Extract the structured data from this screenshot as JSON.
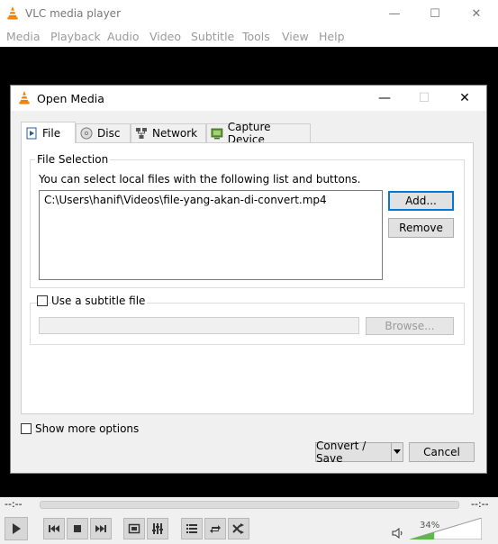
{
  "app": {
    "title": "VLC media player",
    "window_controls": {
      "minimize": "—",
      "maximize": "☐",
      "close": "✕"
    }
  },
  "menubar": {
    "items": [
      "Media",
      "Playback",
      "Audio",
      "Video",
      "Subtitle",
      "Tools",
      "View",
      "Help"
    ]
  },
  "playback": {
    "time_elapsed": "--:--",
    "time_total": "--:--",
    "volume_percent_label": "34%",
    "volume_fraction": 0.34
  },
  "dialog": {
    "title": "Open Media",
    "tabs": [
      {
        "label": "File",
        "icon": "file-icon",
        "active": true
      },
      {
        "label": "Disc",
        "icon": "disc-icon",
        "active": false
      },
      {
        "label": "Network",
        "icon": "network-icon",
        "active": false
      },
      {
        "label": "Capture Device",
        "icon": "capture-device-icon",
        "active": false
      }
    ],
    "file_selection": {
      "group_label": "File Selection",
      "description": "You can select local files with the following list and buttons.",
      "files": [
        "C:\\Users\\hanif\\Videos\\file-yang-akan-di-convert.mp4"
      ],
      "add_label": "Add...",
      "remove_label": "Remove"
    },
    "subtitle": {
      "checkbox_label": "Use a subtitle file",
      "checked": false,
      "path_value": "",
      "browse_label": "Browse..."
    },
    "show_more_label": "Show more options",
    "show_more_checked": false,
    "convert_save_label": "Convert / Save",
    "cancel_label": "Cancel"
  },
  "colors": {
    "accent": "#0078d7",
    "vlc_orange": "#f08000",
    "volume_green": "#5fb84a"
  }
}
